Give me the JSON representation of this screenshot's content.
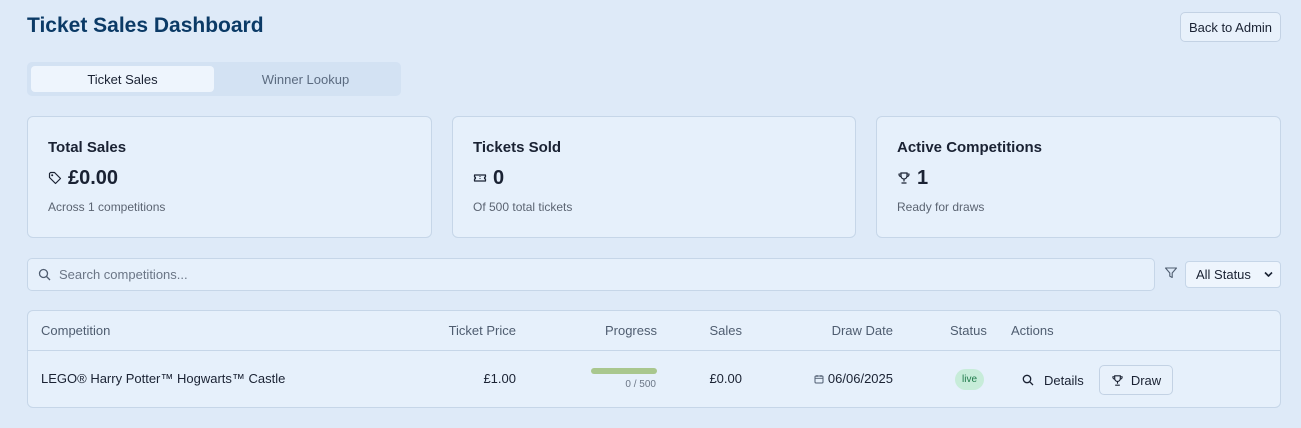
{
  "header": {
    "title": "Ticket Sales Dashboard",
    "back_label": "Back to Admin"
  },
  "tabs": [
    {
      "label": "Ticket Sales",
      "active": true
    },
    {
      "label": "Winner Lookup",
      "active": false
    }
  ],
  "stats": [
    {
      "title": "Total Sales",
      "icon": "tag-icon",
      "value": "£0.00",
      "sub": "Across 1 competitions"
    },
    {
      "title": "Tickets Sold",
      "icon": "ticket-icon",
      "value": "0",
      "sub": "Of 500 total tickets"
    },
    {
      "title": "Active Competitions",
      "icon": "trophy-icon",
      "value": "1",
      "sub": "Ready for draws"
    }
  ],
  "search": {
    "placeholder": "Search competitions...",
    "value": ""
  },
  "filter": {
    "selected": "All Status"
  },
  "table": {
    "columns": {
      "competition": "Competition",
      "price": "Ticket Price",
      "progress": "Progress",
      "sales": "Sales",
      "draw_date": "Draw Date",
      "status": "Status",
      "actions": "Actions"
    },
    "rows": [
      {
        "competition": "LEGO® Harry Potter™ Hogwarts™ Castle",
        "price": "£1.00",
        "progress_text": "0 / 500",
        "progress_fraction": 0,
        "sales": "£0.00",
        "draw_date": "06/06/2025",
        "status": "live",
        "details_label": "Details",
        "draw_label": "Draw"
      }
    ]
  },
  "colors": {
    "background": "#deeaf8",
    "title": "#0b3a66",
    "badge_bg": "#c7ecd9",
    "badge_text": "#1f7a4a",
    "progress": "#a9c78e"
  }
}
